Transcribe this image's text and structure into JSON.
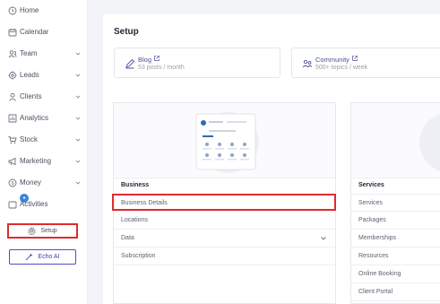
{
  "sidebar": {
    "items": [
      {
        "label": "Home",
        "icon": "home-icon",
        "has_chevron": false
      },
      {
        "label": "Calendar",
        "icon": "calendar-icon",
        "has_chevron": false
      },
      {
        "label": "Team",
        "icon": "team-icon",
        "has_chevron": true
      },
      {
        "label": "Leads",
        "icon": "leads-icon",
        "has_chevron": true
      },
      {
        "label": "Clients",
        "icon": "clients-icon",
        "has_chevron": true
      },
      {
        "label": "Analytics",
        "icon": "analytics-icon",
        "has_chevron": true
      },
      {
        "label": "Stock",
        "icon": "cart-icon",
        "has_chevron": true
      },
      {
        "label": "Marketing",
        "icon": "megaphone-icon",
        "has_chevron": true
      },
      {
        "label": "Money",
        "icon": "money-icon",
        "has_chevron": true
      },
      {
        "label": "Activities",
        "icon": "activities-icon",
        "has_chevron": false
      }
    ],
    "setup_label": "Setup",
    "echo_label": "Echo AI"
  },
  "main": {
    "title": "Setup",
    "cards": [
      {
        "title": "Blog",
        "subtitle": "53 posts / month"
      },
      {
        "title": "Community",
        "subtitle": "500+ topics / week"
      }
    ],
    "business": {
      "heading": "Business",
      "rows": [
        "Business Details",
        "Locations",
        "Data",
        "Subscription"
      ]
    },
    "services": {
      "heading": "Services",
      "rows": [
        "Services",
        "Packages",
        "Memberships",
        "Resources",
        "Online Booking",
        "Client Portal"
      ]
    }
  },
  "colors": {
    "accent": "#4a4f9a",
    "highlight": "#e02b2b",
    "badge": "#3a86d9"
  }
}
